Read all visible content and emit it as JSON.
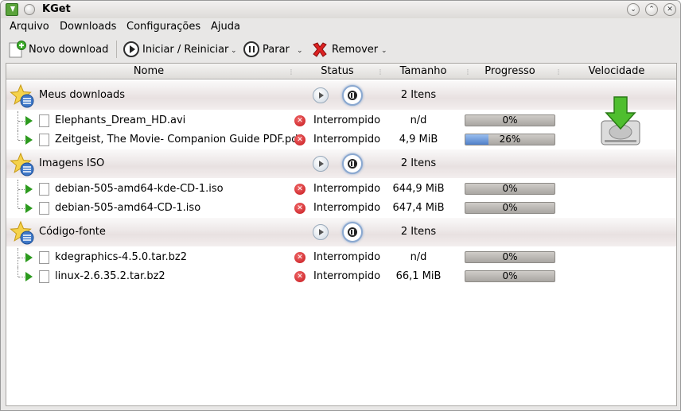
{
  "window": {
    "title": "KGet"
  },
  "menu": [
    "Arquivo",
    "Downloads",
    "Configurações",
    "Ajuda"
  ],
  "toolbar": {
    "new": "Novo download",
    "start": "Iniciar / Reiniciar",
    "stop": "Parar",
    "remove": "Remover"
  },
  "columns": [
    "Nome",
    "Status",
    "Tamanho",
    "Progresso",
    "Velocidade"
  ],
  "groups": [
    {
      "name": "Meus downloads",
      "items": "2 Itens",
      "rows": [
        {
          "name": "Elephants_Dream_HD.avi",
          "status": "Interrompido",
          "size": "n/d",
          "progress": "0%",
          "fraction": 0,
          "icon": "video-file-icon"
        },
        {
          "name": "Zeitgeist, The Movie- Companion Guide PDF.pdf",
          "status": "Interrompido",
          "size": "4,9 MiB",
          "progress": "26%",
          "fraction": 0.26,
          "icon": "pdf-file-icon"
        }
      ]
    },
    {
      "name": "Imagens ISO",
      "items": "2 Itens",
      "rows": [
        {
          "name": "debian-505-amd64-kde-CD-1.iso",
          "status": "Interrompido",
          "size": "644,9 MiB",
          "progress": "0%",
          "fraction": 0,
          "icon": "disc-image-icon"
        },
        {
          "name": "debian-505-amd64-CD-1.iso",
          "status": "Interrompido",
          "size": "647,4 MiB",
          "progress": "0%",
          "fraction": 0,
          "icon": "disc-image-icon"
        }
      ]
    },
    {
      "name": "Código-fonte",
      "items": "2 Itens",
      "rows": [
        {
          "name": "kdegraphics-4.5.0.tar.bz2",
          "status": "Interrompido",
          "size": "n/d",
          "progress": "0%",
          "fraction": 0,
          "icon": "archive-file-icon"
        },
        {
          "name": "linux-2.6.35.2.tar.bz2",
          "status": "Interrompido",
          "size": "66,1 MiB",
          "progress": "0%",
          "fraction": 0,
          "icon": "archive-file-icon"
        }
      ]
    }
  ]
}
